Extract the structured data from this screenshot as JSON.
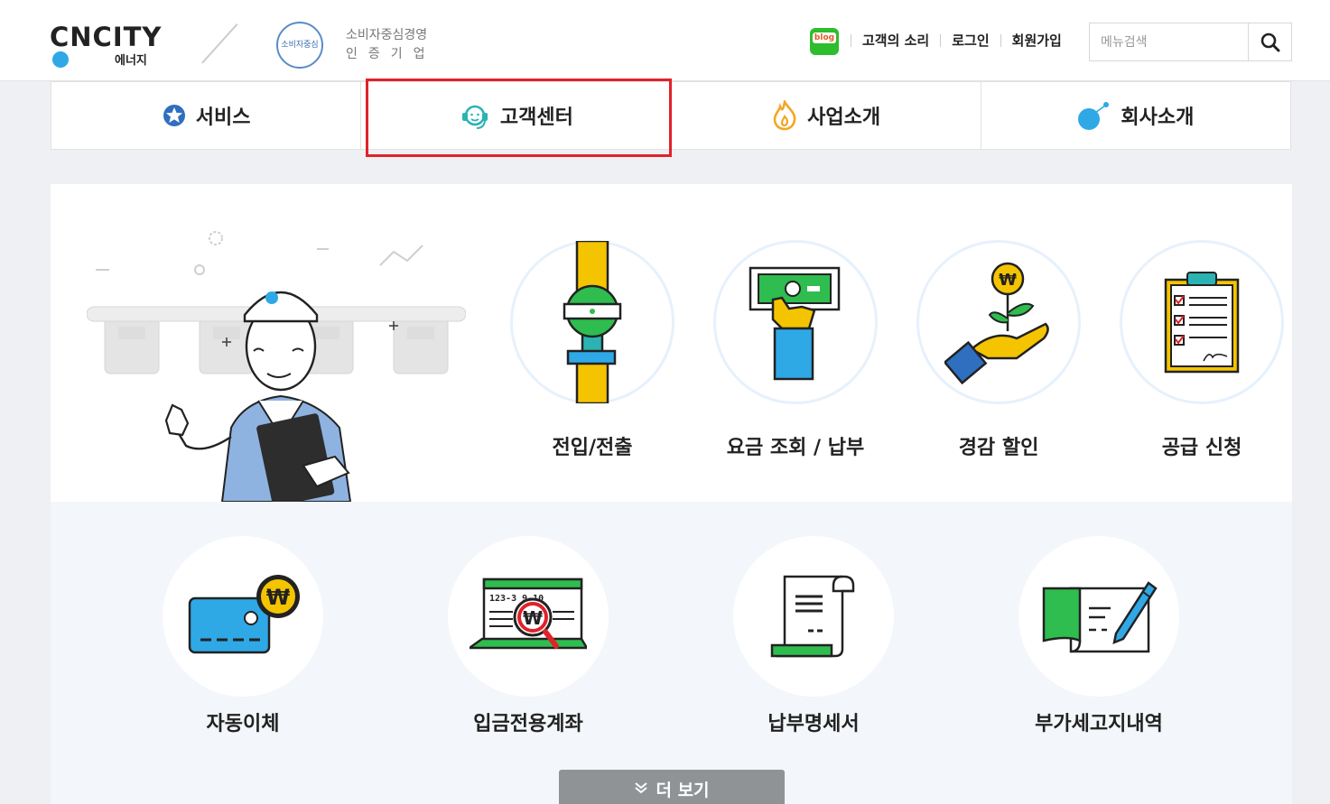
{
  "header": {
    "logo_text": "CNCITY",
    "logo_sub": "에너지",
    "cert_badge": "소비자중심",
    "cert_line1": "소비자중심경영",
    "cert_line2": "인증기업",
    "blog_label": "blog",
    "links": [
      "고객의 소리",
      "로그인",
      "회원가입"
    ],
    "search_placeholder": "메뉴검색"
  },
  "nav": {
    "items": [
      "서비스",
      "고객센터",
      "사업소개",
      "회사소개"
    ],
    "highlighted": "고객센터"
  },
  "services_top": [
    "전입/전출",
    "요금 조회 / 납부",
    "경감 할인",
    "공급 신청"
  ],
  "services_bottom": [
    "자동이체",
    "입금전용계좌",
    "납부명세서",
    "부가세고지내역"
  ],
  "account_sample": "123-3 9-10",
  "more_button": "더 보기",
  "colors": {
    "accent": "#e0222a",
    "blue": "#2fa8e6",
    "yellow": "#f5c400",
    "green": "#2ebd4e"
  }
}
